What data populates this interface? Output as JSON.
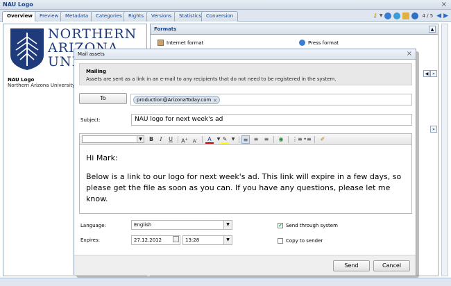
{
  "window": {
    "title": "NAU Logo"
  },
  "tabs": [
    "Overview",
    "Preview",
    "Metadata",
    "Categories",
    "Rights",
    "Versions",
    "Statistics",
    "Conversion"
  ],
  "nav": {
    "counter": "4 / 5"
  },
  "asset": {
    "logo_text": "NORTHERN\nARIZONA\nUNI",
    "name": "NAU Logo",
    "owner": "Northern Arizona University"
  },
  "formats_panel": {
    "title": "Formats",
    "internet_format": "Internet format",
    "press_format": "Press format"
  },
  "dialog": {
    "title": "Mail assets",
    "info_title": "Mailing",
    "info_text": "Assets are sent as a link in an e-mail to any recipients that do not need to be registered in the system.",
    "to_button": "To",
    "recipient": "production@ArizonaToday.com",
    "subject_label": "Subject:",
    "subject": "NAU logo for next week's ad",
    "body_greeting": "Hi Mark:",
    "body_text": "Below is a link to our logo for next week's ad. This link will expire in a few days, so please get the file as soon as you can. If you have any questions, please let me know.",
    "language_label": "Language:",
    "language": "English",
    "expires_label": "Expires:",
    "expires_date": "27.12.2012",
    "expires_time": "13:28",
    "send_through_system": "Send through system",
    "send_through_system_checked": true,
    "copy_to_sender": "Copy to sender",
    "copy_to_sender_checked": false,
    "send_button": "Send",
    "cancel_button": "Cancel"
  },
  "colors": {
    "brand_blue": "#1f3b7c",
    "title_blue": "#15428b",
    "chrome": "#dfe6ef"
  }
}
